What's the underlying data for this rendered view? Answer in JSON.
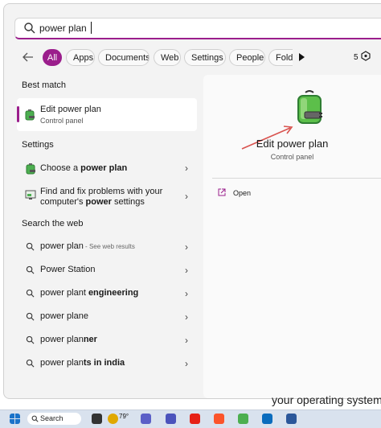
{
  "search": {
    "query": "power plan"
  },
  "filters": [
    "All",
    "Apps",
    "Documents",
    "Web",
    "Settings",
    "People",
    "Folde"
  ],
  "filter_extra": {
    "count": "5"
  },
  "colors": {
    "accent": "#9b1e8c"
  },
  "best_match": {
    "heading": "Best match",
    "title": "Edit power plan",
    "subtitle": "Control panel"
  },
  "settings": {
    "heading": "Settings",
    "item1": {
      "pre": "Choose a ",
      "bold": "power plan"
    },
    "item2": {
      "line1": "Find and fix problems with your",
      "line2_pre": "computer's ",
      "line2_bold": "power",
      "line2_post": " settings"
    }
  },
  "web": {
    "heading": "Search the web",
    "items": [
      {
        "pre": "power plan",
        "bold": "",
        "suffix": " - See web results"
      },
      {
        "pre": "Power Station",
        "bold": "",
        "suffix": ""
      },
      {
        "pre": "power plant ",
        "bold": "engineering",
        "suffix": ""
      },
      {
        "pre": "power plane",
        "bold": "",
        "suffix": ""
      },
      {
        "pre": "power plan",
        "bold": "ner",
        "suffix": ""
      },
      {
        "pre": "power plan",
        "bold": "ts in india",
        "suffix": ""
      }
    ]
  },
  "preview": {
    "title": "Edit power plan",
    "subtitle": "Control panel",
    "action": "Open"
  },
  "background_text": "your operating system",
  "taskbar": {
    "search_label": "Search",
    "weather": "79°"
  }
}
